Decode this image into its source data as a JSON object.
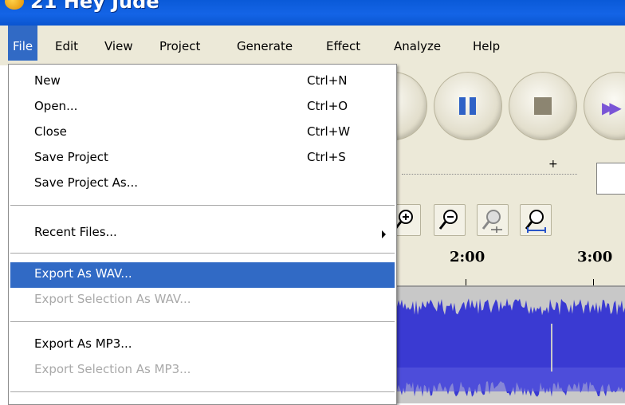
{
  "window": {
    "title": "21 Hey Jude"
  },
  "menubar": {
    "items": [
      {
        "label": "File",
        "active": true
      },
      {
        "label": "Edit"
      },
      {
        "label": "View"
      },
      {
        "label": "Project"
      },
      {
        "label": "Generate"
      },
      {
        "label": "Effect"
      },
      {
        "label": "Analyze"
      },
      {
        "label": "Help"
      }
    ]
  },
  "file_menu": {
    "items": [
      {
        "label": "New",
        "shortcut": "Ctrl+N",
        "enabled": true
      },
      {
        "label": "Open...",
        "shortcut": "Ctrl+O",
        "enabled": true
      },
      {
        "label": "Close",
        "shortcut": "Ctrl+W",
        "enabled": true
      },
      {
        "label": "Save Project",
        "shortcut": "Ctrl+S",
        "enabled": true
      },
      {
        "label": "Save Project As...",
        "shortcut": "",
        "enabled": true
      },
      {
        "label": "Recent Files...",
        "shortcut": "",
        "enabled": true,
        "submenu": true
      },
      {
        "label": "Export As WAV...",
        "shortcut": "",
        "enabled": true,
        "highlighted": true
      },
      {
        "label": "Export Selection As WAV...",
        "shortcut": "",
        "enabled": false
      },
      {
        "label": "Export As MP3...",
        "shortcut": "",
        "enabled": true
      },
      {
        "label": "Export Selection As MP3...",
        "shortcut": "",
        "enabled": false
      }
    ]
  },
  "timeline": {
    "ticks": [
      "2:00",
      "3:00"
    ]
  },
  "meter": {
    "plus_label": "+"
  },
  "icons": {
    "transport": [
      "pause-icon",
      "stop-icon",
      "fast-forward-icon"
    ],
    "zoom": [
      "zoom-in-icon",
      "zoom-out-icon",
      "zoom-fit-icon",
      "zoom-selection-icon"
    ]
  },
  "colors": {
    "menu_highlight": "#316ac5",
    "titlebar": "#0a5ad8",
    "waveform": "#3a3ad2",
    "chrome": "#ece9d8"
  }
}
